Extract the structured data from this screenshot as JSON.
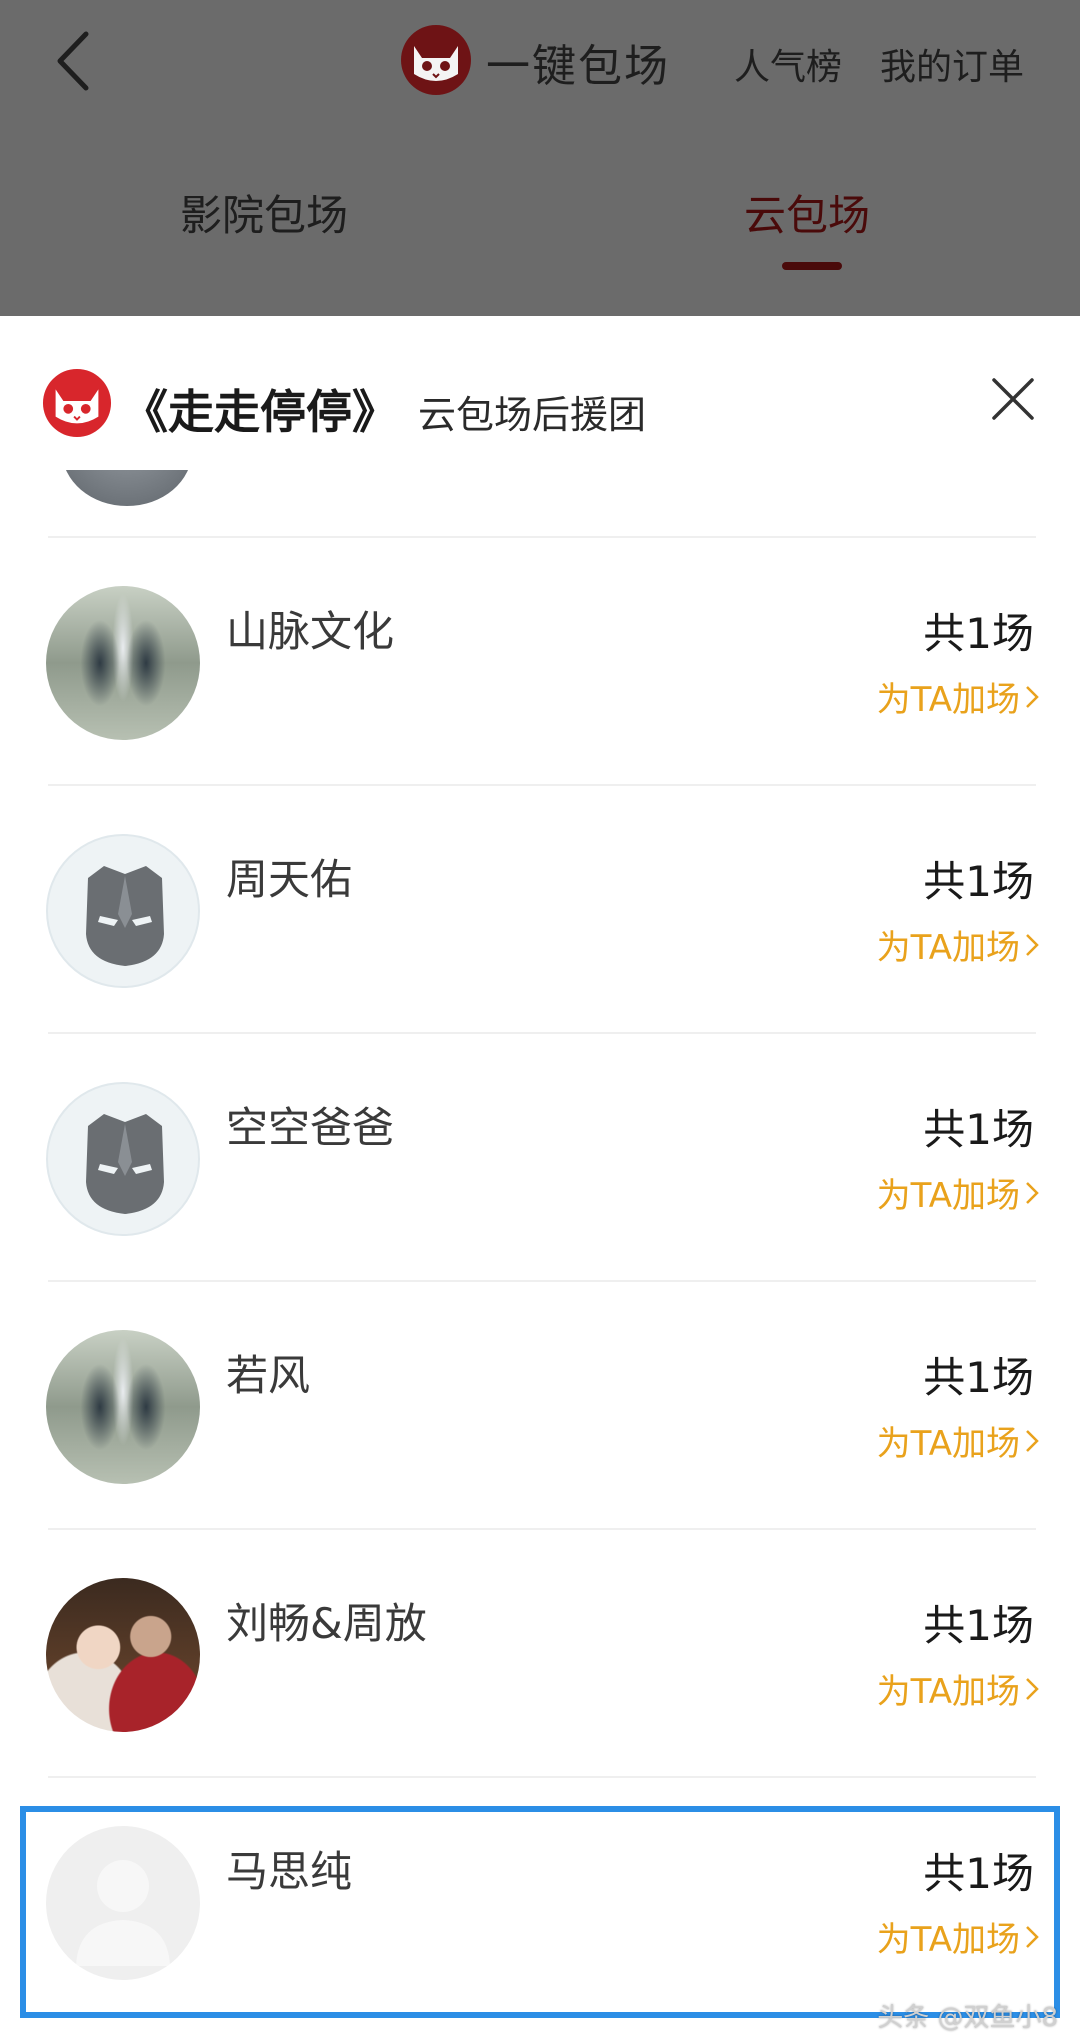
{
  "header": {
    "title": "一键包场",
    "nav_popular": "人气榜",
    "nav_orders": "我的订单",
    "tabs": [
      {
        "label": "影院包场",
        "active": false
      },
      {
        "label": "云包场",
        "active": true
      }
    ]
  },
  "sheet": {
    "film_title": "《走走停停》",
    "subtitle": "云包场后援团",
    "rows": [
      {
        "name": "山脉文化",
        "count": "共1场",
        "action": "为TA加场",
        "avatar": "landscape-avatar"
      },
      {
        "name": "周天佑",
        "count": "共1场",
        "action": "为TA加场",
        "avatar": "mask-avatar"
      },
      {
        "name": "空空爸爸",
        "count": "共1场",
        "action": "为TA加场",
        "avatar": "mask-avatar"
      },
      {
        "name": "若风",
        "count": "共1场",
        "action": "为TA加场",
        "avatar": "landscape-avatar"
      },
      {
        "name": "刘畅&周放",
        "count": "共1场",
        "action": "为TA加场",
        "avatar": "photo-avatar"
      },
      {
        "name": "马思纯",
        "count": "共1场",
        "action": "为TA加场",
        "avatar": "default-avatar"
      }
    ]
  },
  "watermark": "头条 @双鱼小8",
  "colors": {
    "accent_red": "#d8262c",
    "action_orange": "#e9a21c",
    "highlight_blue": "#2b8ee6"
  }
}
